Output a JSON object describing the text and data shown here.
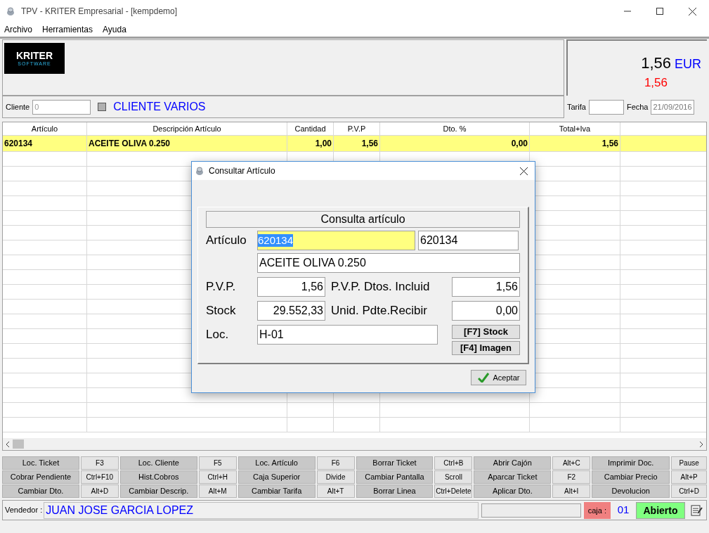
{
  "window": {
    "title": "TPV - KRITER Empresarial -  [kempdemo]"
  },
  "menu": [
    "Archivo",
    "Herramientas",
    "Ayuda"
  ],
  "logo": {
    "name": "KRITER",
    "tagline": "SOFTWARE"
  },
  "totals": {
    "amount": "1,56",
    "currency": "EUR",
    "secondary": "1,56"
  },
  "client": {
    "label": "Cliente",
    "value": "0",
    "checked": false,
    "name": "CLIENTE VARIOS",
    "tarifa_label": "Tarifa",
    "fecha_label": "Fecha",
    "fecha_value": "21/09/2016"
  },
  "table": {
    "columns": [
      "Artículo",
      "Descripción Artículo",
      "Cantidad",
      "P.V.P",
      "Dto. %",
      "Total+Iva"
    ],
    "rows": [
      {
        "cells": [
          "620134",
          "ACEITE OLIVA 0.250",
          "1,00",
          "1,56",
          "0,00",
          "1,56"
        ],
        "selected": true
      }
    ]
  },
  "function_keys": [
    [
      {
        "label": "Loc. Ticket",
        "key": "F3"
      },
      {
        "label": "Loc. Cliente",
        "key": "F5"
      },
      {
        "label": "Loc. Artículo",
        "key": "F6"
      },
      {
        "label": "Borrar Ticket",
        "key": "Ctrl+B"
      },
      {
        "label": "Abrir Cajón",
        "key": "Alt+C"
      },
      {
        "label": "Imprimir Doc.",
        "key": "Pause"
      }
    ],
    [
      {
        "label": "Cobrar Pendiente",
        "key": "Ctrl+F10"
      },
      {
        "label": "Hist.Cobros",
        "key": "Ctrl+H"
      },
      {
        "label": "Caja Superior",
        "key": "Divide"
      },
      {
        "label": "Cambiar Pantalla",
        "key": "Scroll"
      },
      {
        "label": "Aparcar Ticket",
        "key": "F2"
      },
      {
        "label": "Cambiar Precio",
        "key": "Alt+P"
      }
    ],
    [
      {
        "label": "Cambiar Dto.",
        "key": "Alt+D"
      },
      {
        "label": "Cambiar Descrip.",
        "key": "Alt+M"
      },
      {
        "label": "Cambiar Tarifa",
        "key": "Alt+T"
      },
      {
        "label": "Borrar Linea",
        "key": "Ctrl+Delete"
      },
      {
        "label": "Aplicar Dto.",
        "key": "Alt+I"
      },
      {
        "label": "Devolucion",
        "key": "Ctrl+D"
      }
    ]
  ],
  "status_bar": {
    "vendedor_label": "Vendedor :",
    "vendedor": "JUAN JOSE GARCIA LOPEZ",
    "caja_label": "caja :",
    "caja": "01",
    "estado": "Abierto"
  },
  "dialog": {
    "title": "Consultar Artículo",
    "heading": "Consulta artículo",
    "articulo_label": "Artículo",
    "articulo_value": "620134",
    "articulo_value_selected": true,
    "articulo_code": "620134",
    "descripcion": "ACEITE OLIVA 0.250",
    "pvp_label": "P.V.P.",
    "pvp": "1,56",
    "pvp_dtos_label": "P.V.P. Dtos. Incluid",
    "pvp_dtos": "1,56",
    "stock_label": "Stock",
    "stock": "29.552,33",
    "pdte_label": "Unid. Pdte.Recibir",
    "pdte": "0,00",
    "loc_label": "Loc.",
    "loc": "H-01",
    "stock_button": "[F7] Stock",
    "imagen_button": "[F4] Imagen",
    "accept_button": "Aceptar"
  }
}
